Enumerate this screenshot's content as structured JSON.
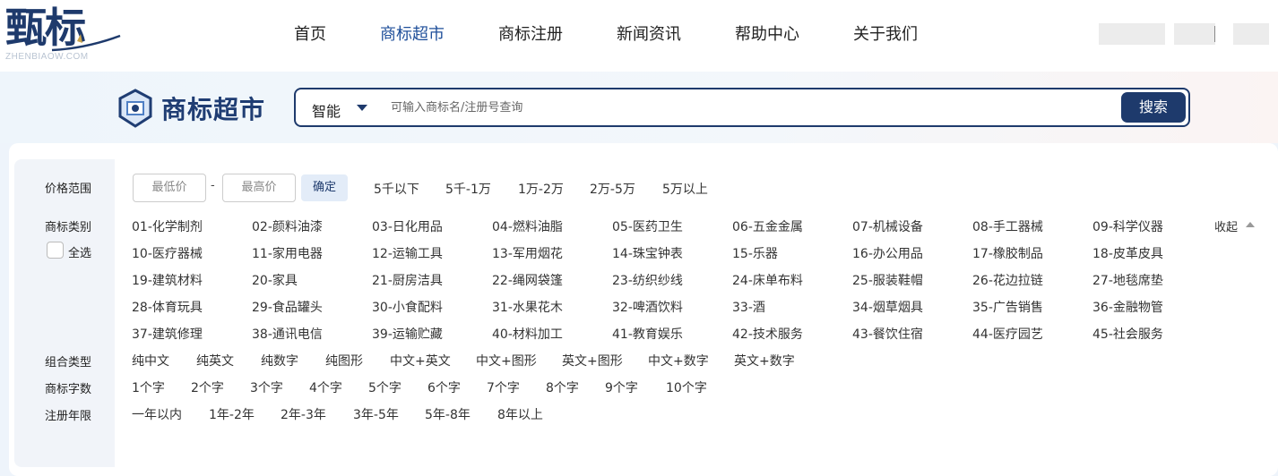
{
  "header": {
    "logo_text": "甄标",
    "logo_sub": "ZHENBIAOW.COM",
    "nav": [
      "首页",
      "商标超市",
      "商标注册",
      "新闻资讯",
      "帮助中心",
      "关于我们"
    ],
    "active_nav": "商标超市"
  },
  "search": {
    "section_title": "商标超市",
    "mode": "智能",
    "placeholder": "可输入商标名/注册号查询",
    "button": "搜索"
  },
  "filters": {
    "price": {
      "label": "价格范围",
      "min_placeholder": "最低价",
      "max_placeholder": "最高价",
      "dash": "-",
      "confirm": "确定",
      "options": [
        "5千以下",
        "5千-1万",
        "1万-2万",
        "2万-5万",
        "5万以上"
      ]
    },
    "category": {
      "label": "商标类别",
      "select_all": "全选",
      "collapse": "收起",
      "items": [
        "01-化学制剂",
        "02-颜料油漆",
        "03-日化用品",
        "04-燃料油脂",
        "05-医药卫生",
        "06-五金金属",
        "07-机械设备",
        "08-手工器械",
        "09-科学仪器",
        "10-医疗器械",
        "11-家用电器",
        "12-运输工具",
        "13-军用烟花",
        "14-珠宝钟表",
        "15-乐器",
        "16-办公用品",
        "17-橡胶制品",
        "18-皮革皮具",
        "19-建筑材料",
        "20-家具",
        "21-厨房洁具",
        "22-绳网袋篷",
        "23-纺织纱线",
        "24-床单布料",
        "25-服装鞋帽",
        "26-花边拉链",
        "27-地毯席垫",
        "28-体育玩具",
        "29-食品罐头",
        "30-小食配料",
        "31-水果花木",
        "32-啤酒饮料",
        "33-酒",
        "34-烟草烟具",
        "35-广告销售",
        "36-金融物管",
        "37-建筑修理",
        "38-通讯电信",
        "39-运输贮藏",
        "40-材料加工",
        "41-教育娱乐",
        "42-技术服务",
        "43-餐饮住宿",
        "44-医疗园艺",
        "45-社会服务"
      ]
    },
    "combo": {
      "label": "组合类型",
      "options": [
        "纯中文",
        "纯英文",
        "纯数字",
        "纯图形",
        "中文+英文",
        "中文+图形",
        "英文+图形",
        "中文+数字",
        "英文+数字"
      ]
    },
    "char_count": {
      "label": "商标字数",
      "options": [
        "1个字",
        "2个字",
        "3个字",
        "4个字",
        "5个字",
        "6个字",
        "7个字",
        "8个字",
        "9个字",
        "10个字"
      ]
    },
    "years": {
      "label": "注册年限",
      "options": [
        "一年以内",
        "1年-2年",
        "2年-3年",
        "3年-5年",
        "5年-8年",
        "8年以上"
      ]
    }
  },
  "colors": {
    "brand_navy": "#1e3a6c",
    "active_nav": "#1f4f9a",
    "panel_side": "#f1f4f9"
  }
}
